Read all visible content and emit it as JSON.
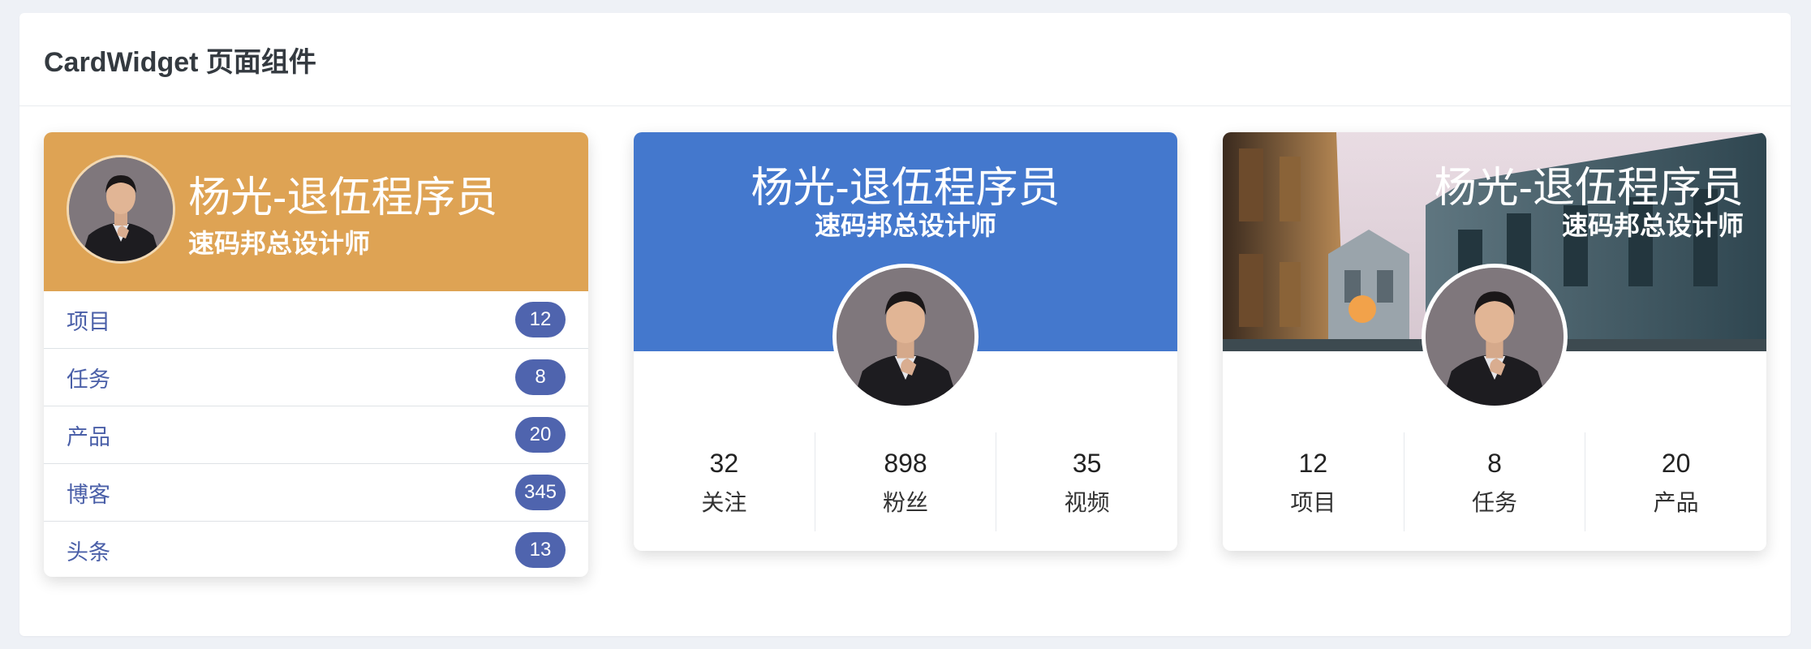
{
  "panel": {
    "title": "CardWidget 页面组件"
  },
  "card1": {
    "name": "杨光-退伍程序员",
    "role": "速码邦总设计师",
    "header_color": "#dea354",
    "items": [
      {
        "label": "项目",
        "count": "12"
      },
      {
        "label": "任务",
        "count": "8"
      },
      {
        "label": "产品",
        "count": "20"
      },
      {
        "label": "博客",
        "count": "345"
      },
      {
        "label": "头条",
        "count": "13"
      }
    ]
  },
  "card2": {
    "name": "杨光-退伍程序员",
    "role": "速码邦总设计师",
    "banner_color": "#4478cd",
    "stats": [
      {
        "value": "32",
        "label": "关注"
      },
      {
        "value": "898",
        "label": "粉丝"
      },
      {
        "value": "35",
        "label": "视频"
      }
    ]
  },
  "card3": {
    "name": "杨光-退伍程序员",
    "role": "速码邦总设计师",
    "banner_image": "city-street-photo",
    "stats": [
      {
        "value": "12",
        "label": "项目"
      },
      {
        "value": "8",
        "label": "任务"
      },
      {
        "value": "20",
        "label": "产品"
      }
    ]
  },
  "colors": {
    "accent": "#4f64ae",
    "badge_text": "#ffffff",
    "link": "#4a5fa8"
  }
}
